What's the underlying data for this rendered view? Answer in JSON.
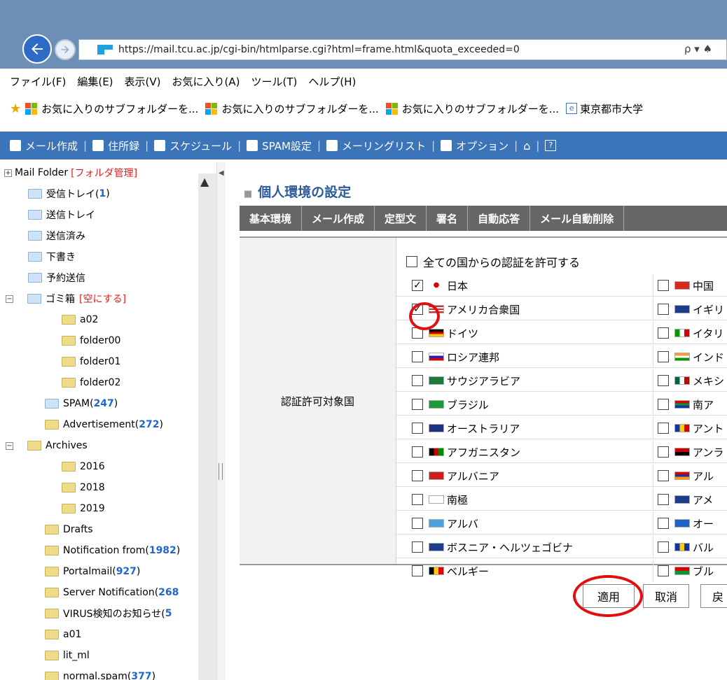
{
  "browser": {
    "url": "https://mail.tcu.ac.jp/cgi-bin/htmlparse.cgi?html=frame.html&quota_exceeded=0",
    "search_glyph": "ρ ▾ ♠"
  },
  "menu": [
    "ファイル(F)",
    "編集(E)",
    "表示(V)",
    "お気に入り(A)",
    "ツール(T)",
    "ヘルプ(H)"
  ],
  "favorites": [
    "お気に入りのサブフォルダーを...",
    "お気に入りのサブフォルダーを...",
    "お気に入りのサブフォルダーを...",
    "東京都市大学"
  ],
  "toolbar": [
    {
      "label": "メール作成",
      "icon": "compose-icon"
    },
    {
      "label": "住所録",
      "icon": "addressbook-icon"
    },
    {
      "label": "スケジュール",
      "icon": "calendar-icon"
    },
    {
      "label": "SPAM設定",
      "icon": "spam-icon"
    },
    {
      "label": "メーリングリスト",
      "icon": "mailinglist-icon"
    },
    {
      "label": "オプション",
      "icon": "options-icon"
    }
  ],
  "sidebar": {
    "root_label": "Mail Folder",
    "root_manage": "[フォルダ管理]",
    "folders": [
      {
        "name": "受信トレイ(",
        "count": "1",
        "tail": ")"
      },
      {
        "name": "送信トレイ"
      },
      {
        "name": "送信済み"
      },
      {
        "name": "下書き"
      },
      {
        "name": "予約送信"
      },
      {
        "name": "ゴミ箱",
        "action": "[空にする]"
      },
      {
        "name": "a02"
      },
      {
        "name": "folder00"
      },
      {
        "name": "folder01"
      },
      {
        "name": "folder02"
      },
      {
        "name": "SPAM(",
        "count": "247",
        "tail": ")"
      },
      {
        "name": "Advertisement(",
        "count": "272",
        "tail": ")"
      },
      {
        "name": "Archives"
      },
      {
        "name": "2016"
      },
      {
        "name": "2018"
      },
      {
        "name": "2019"
      },
      {
        "name": "Drafts"
      },
      {
        "name": "Notification from(",
        "count": "1982",
        "tail": ")"
      },
      {
        "name": "Portalmail(",
        "count": "927",
        "tail": ")"
      },
      {
        "name": "Server Notification(",
        "count": "268",
        "tail": ""
      },
      {
        "name": "VIRUS検知のお知らせ(",
        "count": "5",
        "tail": ""
      },
      {
        "name": "a01"
      },
      {
        "name": "lit_ml"
      },
      {
        "name": "normal.spam(",
        "count": "377",
        "tail": ")"
      }
    ]
  },
  "main": {
    "title": "個人環境の設定",
    "tabs": [
      "基本環境",
      "メール作成",
      "定型文",
      "署名",
      "自動応答",
      "メール自動削除"
    ],
    "field_label": "認証許可対象国",
    "all_countries": "全ての国からの認証を許可する",
    "countries": [
      {
        "left": "日本",
        "left_checked": true,
        "right": "中国"
      },
      {
        "left": "アメリカ合衆国",
        "left_checked": true,
        "right": "イギリ"
      },
      {
        "left": "ドイツ",
        "left_checked": false,
        "right": "イタリ"
      },
      {
        "left": "ロシア連邦",
        "left_checked": false,
        "right": "インド"
      },
      {
        "left": "サウジアラビア",
        "left_checked": false,
        "right": "メキシ"
      },
      {
        "left": "ブラジル",
        "left_checked": false,
        "right": "南ア"
      },
      {
        "left": "オーストラリア",
        "left_checked": false,
        "right": "アント"
      },
      {
        "left": "アフガニスタン",
        "left_checked": false,
        "right": "アンラ"
      },
      {
        "left": "アルバニア",
        "left_checked": false,
        "right": "アル"
      },
      {
        "left": "南極",
        "left_checked": false,
        "right": "アメ"
      },
      {
        "left": "アルバ",
        "left_checked": false,
        "right": "オー"
      },
      {
        "left": "ボスニア・ヘルツェゴビナ",
        "left_checked": false,
        "right": "バル"
      },
      {
        "left": "ベルギー",
        "left_checked": false,
        "right": "ブル"
      }
    ],
    "buttons": {
      "apply": "適用",
      "cancel": "取消",
      "back": "戻"
    }
  }
}
